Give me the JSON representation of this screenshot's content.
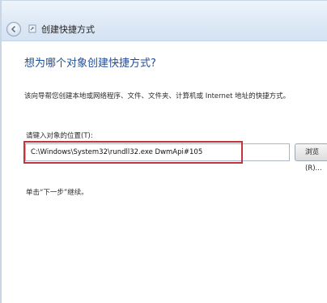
{
  "window": {
    "title": "创建快捷方式"
  },
  "page": {
    "heading": "想为哪个对象创建快捷方式?",
    "description": "该向导帮您创建本地或网络程序、文件、文件夹、计算机或 Internet 地址的快捷方式。",
    "location_label": "请键入对象的位置(T):",
    "location_value": "C:\\Windows\\System32\\rundll32.exe DwmApi#105",
    "browse_label": "浏览(R)...",
    "next_hint": "单击“下一步”继续。"
  },
  "colors": {
    "heading": "#1f4e9b",
    "highlight_box": "#c0363c"
  },
  "icons": {
    "back": "back-arrow-icon",
    "wizard": "shortcut-wizard-icon"
  }
}
